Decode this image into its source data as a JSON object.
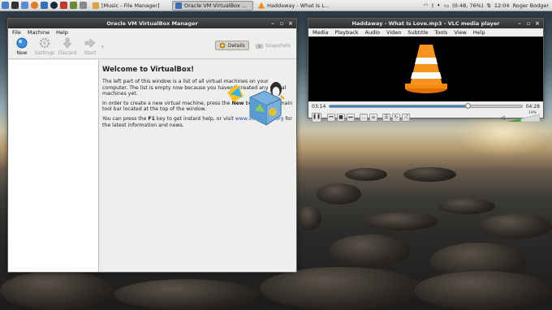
{
  "taskbar": {
    "tasks": [
      {
        "label": "[Music - File Manager]",
        "active": false
      },
      {
        "label": "Oracle VM VirtualBox ...",
        "active": true
      },
      {
        "label": "Haddaway - What Is L...",
        "active": false
      }
    ],
    "battery": "(0:48, 76%)",
    "clock": "12:04",
    "user": "Roger Bodger"
  },
  "vbox": {
    "title": "Oracle VM VirtualBox Manager",
    "menu": [
      "File",
      "Machine",
      "Help"
    ],
    "toolbar": {
      "new": "New",
      "settings": "Settings",
      "discard": "Discard",
      "start": "Start"
    },
    "details_label": "Details",
    "snapshots_label": "Snapshots",
    "welcome_title": "Welcome to VirtualBox!",
    "p1": "The left part of this window is a list of all virtual machines on your computer. The list is empty now because you haven't created any virtual machines yet.",
    "p2_a": "In order to create a new virtual machine, press the ",
    "p2_new": "New",
    "p2_b": " button in the main tool bar located at the top of the window.",
    "p3_a": "You can press the ",
    "p3_key": "F1",
    "p3_b": " key to get instant help, or visit ",
    "p3_link": "www.virtualbox.org",
    "p3_c": " for the latest information and news."
  },
  "vlc": {
    "title": "Haddaway - What Is Love.mp3 - VLC media player",
    "menu": [
      "Media",
      "Playback",
      "Audio",
      "Video",
      "Subtitle",
      "Tools",
      "View",
      "Help"
    ],
    "elapsed": "03:14",
    "total": "04:28",
    "progress": 0.724,
    "volume": "19%",
    "volume_level": 0.19
  },
  "colors": {
    "vlc_seek": "#3b7fd0",
    "vlc_cone": "#f28a0c",
    "vbox_link": "#2a4fa6"
  }
}
